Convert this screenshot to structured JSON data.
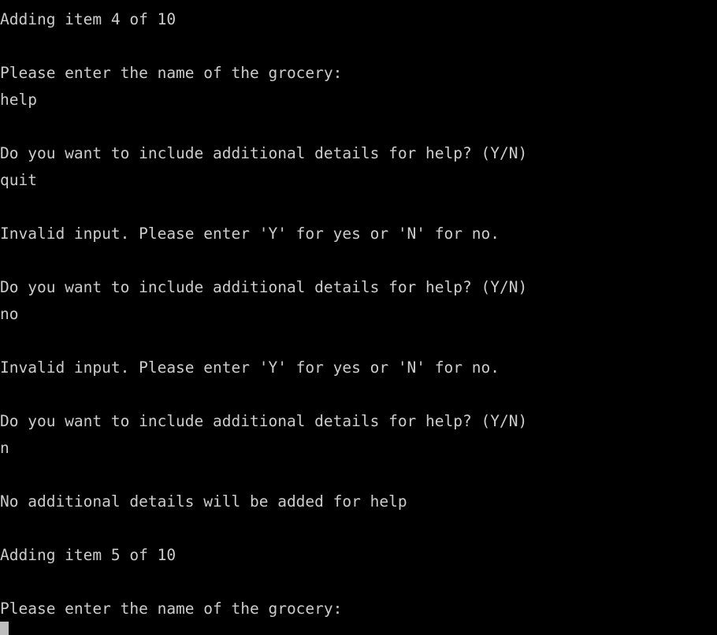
{
  "terminal": {
    "background_color": "#000000",
    "foreground_color": "#cccccc",
    "cursor_color": "#bdbdbd",
    "lines": [
      "Adding item 4 of 10",
      "",
      "Please enter the name of the grocery:",
      "help",
      "",
      "Do you want to include additional details for help? (Y/N)",
      "quit",
      "",
      "Invalid input. Please enter 'Y' for yes or 'N' for no.",
      "",
      "Do you want to include additional details for help? (Y/N)",
      "no",
      "",
      "Invalid input. Please enter 'Y' for yes or 'N' for no.",
      "",
      "Do you want to include additional details for help? (Y/N)",
      "n",
      "",
      "No additional details will be added for help",
      "",
      "Adding item 5 of 10",
      "",
      "Please enter the name of the grocery:"
    ],
    "cursor": {
      "symbol": "block-cursor",
      "row": 23,
      "column": 0
    }
  }
}
